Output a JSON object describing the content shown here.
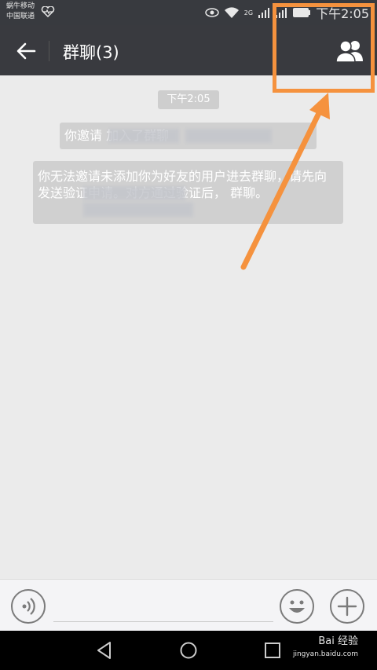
{
  "status_bar": {
    "carrier_1": "蜗牛移动",
    "carrier_2": "中国联通",
    "network": "2G",
    "time": "下午2:05"
  },
  "header": {
    "title": "群聊(3)",
    "back_icon": "back-arrow-icon",
    "group_icon": "group-members-icon"
  },
  "chat": {
    "timestamp": "下午2:05",
    "system_messages": [
      {
        "text": "你邀请                          加入了群聊"
      },
      {
        "text": "你无法邀请未添加你为好友的用户进去群聊，请先向                   发送验证申请。对方通过验证后，                    群聊。"
      }
    ]
  },
  "input_bar": {
    "voice_icon": "voice-icon",
    "emoji_icon": "emoji-icon",
    "plus_icon": "plus-icon"
  },
  "nav_bar": {
    "back_icon": "nav-back-icon",
    "home_icon": "nav-home-icon",
    "recent_icon": "nav-recent-icon"
  },
  "watermark": {
    "brand": "Bai 经验",
    "url": "jingyan.baidu.com"
  },
  "colors": {
    "annotation": "#f5923e",
    "title_bar": "#393a3f",
    "chat_bg": "#ebebeb"
  }
}
